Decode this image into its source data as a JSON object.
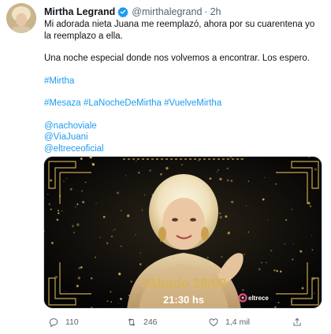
{
  "tweet": {
    "author": {
      "display_name": "Mirtha Legrand",
      "handle": "@mirthalegrand",
      "verified": true,
      "time": "2h"
    },
    "text": {
      "line1": "Mi adorada nieta Juana me reemplazó, ahora por su cuarentena yo la reemplazo a ella.",
      "line2": "Una noche especial donde nos volvemos a encontrar. Los espero.",
      "hashtag1": "#Mirtha",
      "hashtags2": "#Mesaza #LaNocheDeMirtha #VuelveMirtha",
      "mention1": "@nachoviale",
      "mention2": "@ViaJuani",
      "mention3": "@eltreceoficial"
    },
    "media": {
      "date_text": "Sábado 28/08",
      "time_text": "21:30 hs",
      "channel_logo": "eltrece"
    },
    "actions": {
      "reply_count": "110",
      "retweet_count": "246",
      "like_count": "1,4 mil"
    }
  },
  "colors": {
    "link": "#1d9bf0",
    "gold": "#d4b15a",
    "secondary_text": "#536471"
  },
  "icons": [
    "verified-badge-icon",
    "reply-icon",
    "retweet-icon",
    "like-icon",
    "share-icon"
  ]
}
